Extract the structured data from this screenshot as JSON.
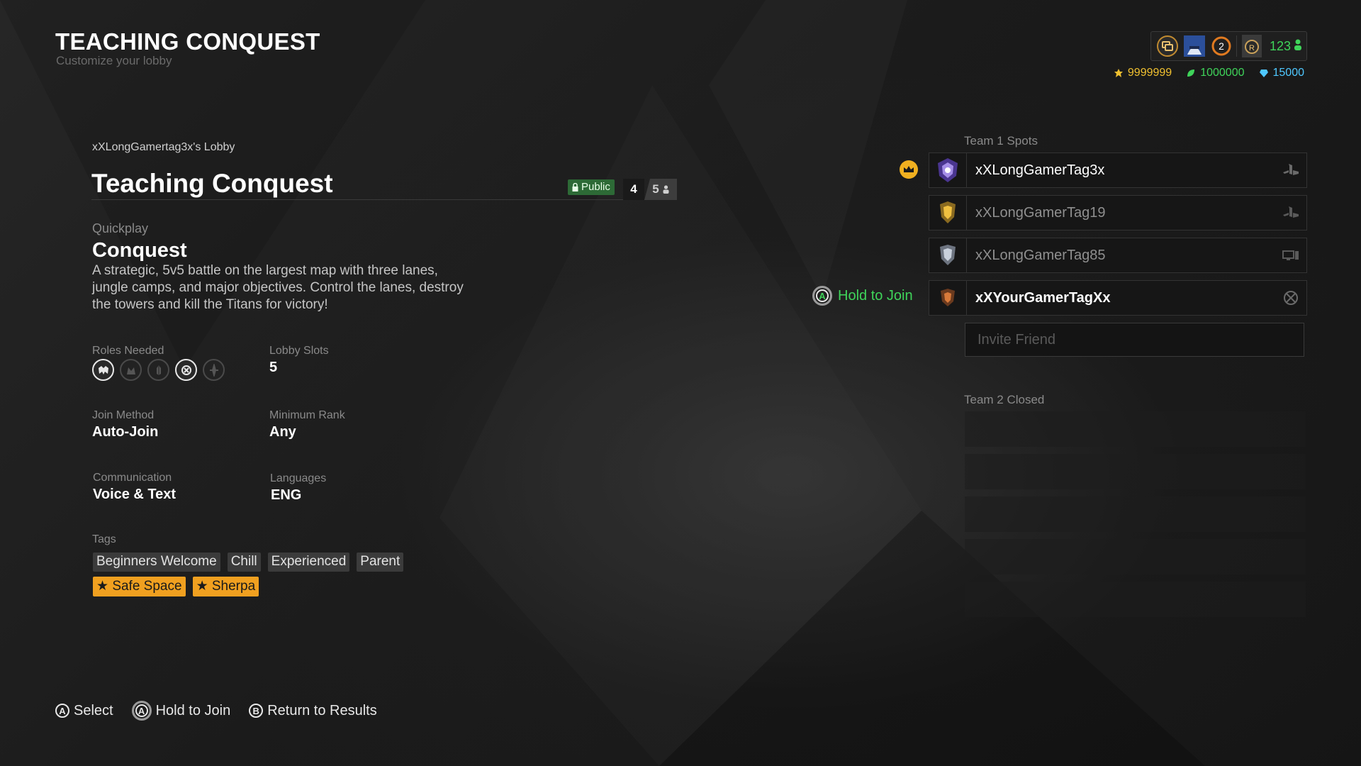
{
  "header": {
    "title": "TEACHING CONQUEST",
    "subtitle": "Customize your lobby"
  },
  "topbar": {
    "icons": [
      "chat-bubbles-icon",
      "player-portrait-icon",
      "notification-count-icon",
      "rank-medal-icon",
      "friends-icon"
    ],
    "notification_count": "2",
    "level": "123",
    "wallet": [
      {
        "icon": "favor-coin-icon",
        "value": "9999999",
        "color": "#f0c030"
      },
      {
        "icon": "leaf-currency-icon",
        "value": "1000000",
        "color": "#3fd45a"
      },
      {
        "icon": "gem-icon",
        "value": "15000",
        "color": "#4fc8ff"
      }
    ]
  },
  "lobby": {
    "owner": "xXLongGamertag3x's Lobby",
    "name": "Teaching Conquest",
    "visibility": "Public",
    "players_current": "4",
    "players_max": "5",
    "mode_label": "Quickplay",
    "mode_name": "Conquest",
    "mode_description": "A strategic, 5v5 battle on the largest map with three lanes, jungle camps, and major objectives.  Control the lanes, destroy the towers and kill the Titans for victory!",
    "roles_label": "Roles Needed",
    "roles": [
      {
        "icon": "guardian-role-icon",
        "needed": true
      },
      {
        "icon": "hunter-role-icon",
        "needed": false
      },
      {
        "icon": "warrior-role-icon",
        "needed": false
      },
      {
        "icon": "mage-role-icon",
        "needed": true
      },
      {
        "icon": "assassin-role-icon",
        "needed": false
      }
    ],
    "slots_label": "Lobby Slots",
    "slots_value": "5",
    "join_label": "Join Method",
    "join_value": "Auto-Join",
    "rank_label": "Minimum Rank",
    "rank_value": "Any",
    "comm_label": "Communication",
    "comm_value": "Voice & Text",
    "lang_label": "Languages",
    "lang_value": "ENG",
    "tags_label": "Tags",
    "tags": [
      "Beginners Welcome",
      "Chill",
      "Experienced",
      "Parent"
    ],
    "special_tags": [
      "Safe Space",
      "Sherpa"
    ]
  },
  "team1": {
    "label": "Team 1 Spots",
    "players": [
      {
        "name": "xXLongGamerTag3x",
        "platform": "playstation-icon",
        "avatar": "purple-crest-avatar",
        "leader": true
      },
      {
        "name": "xXLongGamerTag19",
        "platform": "playstation-icon",
        "avatar": "gold-crest-avatar",
        "leader": false
      },
      {
        "name": "xXLongGamerTag85",
        "platform": "pc-monitor-icon",
        "avatar": "silver-crest-avatar",
        "leader": false
      },
      {
        "name": "xXYourGamerTagXx",
        "platform": "xbox-icon",
        "avatar": "bronze-crest-avatar",
        "leader": false
      }
    ],
    "hold_to_join": "Hold to Join",
    "invite_placeholder": "Invite Friend"
  },
  "team2": {
    "label": "Team 2 Closed"
  },
  "footer": {
    "hints": [
      {
        "button": "A",
        "label": "Select"
      },
      {
        "button": "A",
        "label": "Hold to Join"
      },
      {
        "button": "B",
        "label": "Return to Results"
      }
    ]
  }
}
